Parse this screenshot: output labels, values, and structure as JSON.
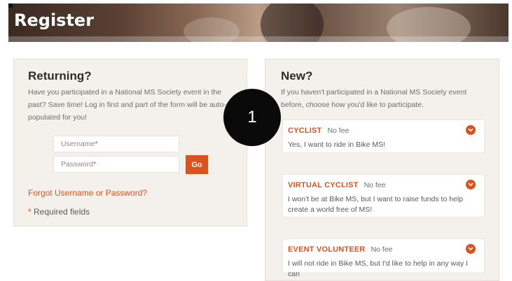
{
  "header": {
    "title": "Register"
  },
  "returning": {
    "title": "Returning?",
    "description": "Have you participated in a National MS Society event in the past? Save time! Log in first and part of the form will be auto-populated for you!",
    "username_label": "Username",
    "password_label": "Password",
    "required_marker": "*",
    "go_label": "Go",
    "forgot_link": "Forgot Username or Password?",
    "required_note": "Required fields"
  },
  "new": {
    "title": "New?",
    "description": "If you haven't participated in a National MS Society event before, choose how you'd like to participate.",
    "options": [
      {
        "name": "CYCLIST",
        "fee": "No fee",
        "text": "Yes, I want to ride in Bike MS!"
      },
      {
        "name": "VIRTUAL CYCLIST",
        "fee": "No fee",
        "text": "I won't be at Bike MS, but I want to raise funds to help create a world free of MS!"
      },
      {
        "name": "EVENT VOLUNTEER",
        "fee": "No fee",
        "text": "I will not ride in Bike MS, but I'd like to help in any way I can"
      }
    ]
  },
  "step_badge": {
    "number": "1"
  },
  "colors": {
    "accent": "#d9531e",
    "panel_bg": "#f4f1ec",
    "text": "#2d2d2d"
  }
}
